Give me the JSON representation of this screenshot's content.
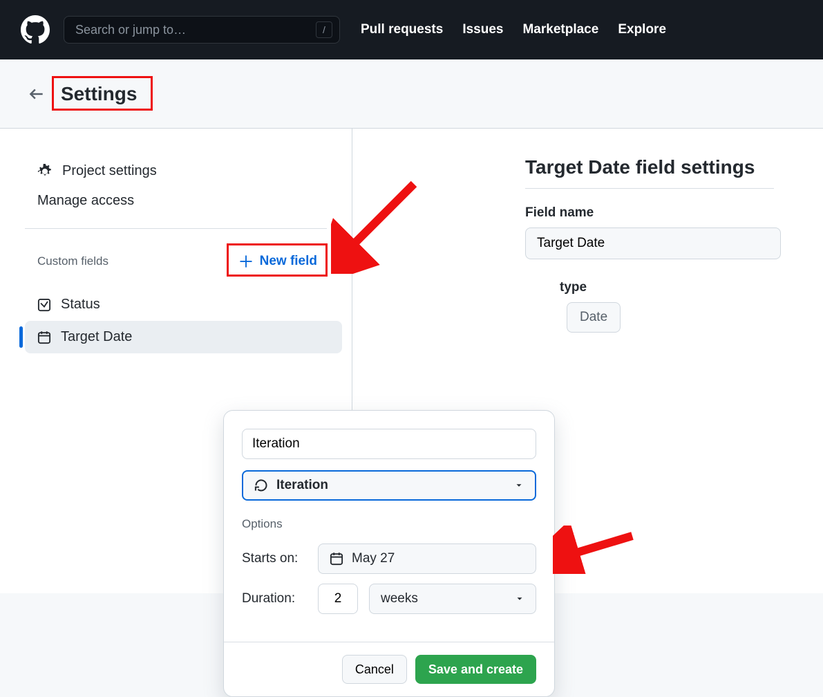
{
  "topnav": {
    "search_placeholder": "Search or jump to…",
    "search_key": "/",
    "links": [
      "Pull requests",
      "Issues",
      "Marketplace",
      "Explore"
    ]
  },
  "header": {
    "title": "Settings"
  },
  "sidebar": {
    "project_settings": "Project settings",
    "manage_access": "Manage access",
    "custom_fields_label": "Custom fields",
    "new_field_label": "New field",
    "fields": [
      {
        "icon": "single-select-icon",
        "label": "Status"
      },
      {
        "icon": "calendar-icon",
        "label": "Target Date"
      }
    ]
  },
  "panel": {
    "title": "Target Date field settings",
    "field_name_label": "Field name",
    "field_name_value": "Target Date",
    "field_type_label": "type",
    "field_type_value": "Date"
  },
  "popover": {
    "name_value": "Iteration",
    "type_select_value": "Iteration",
    "options_label": "Options",
    "starts_on_label": "Starts on:",
    "starts_on_value": "May 27",
    "duration_label": "Duration:",
    "duration_value": "2",
    "duration_unit": "weeks",
    "cancel_label": "Cancel",
    "save_label": "Save and create"
  }
}
